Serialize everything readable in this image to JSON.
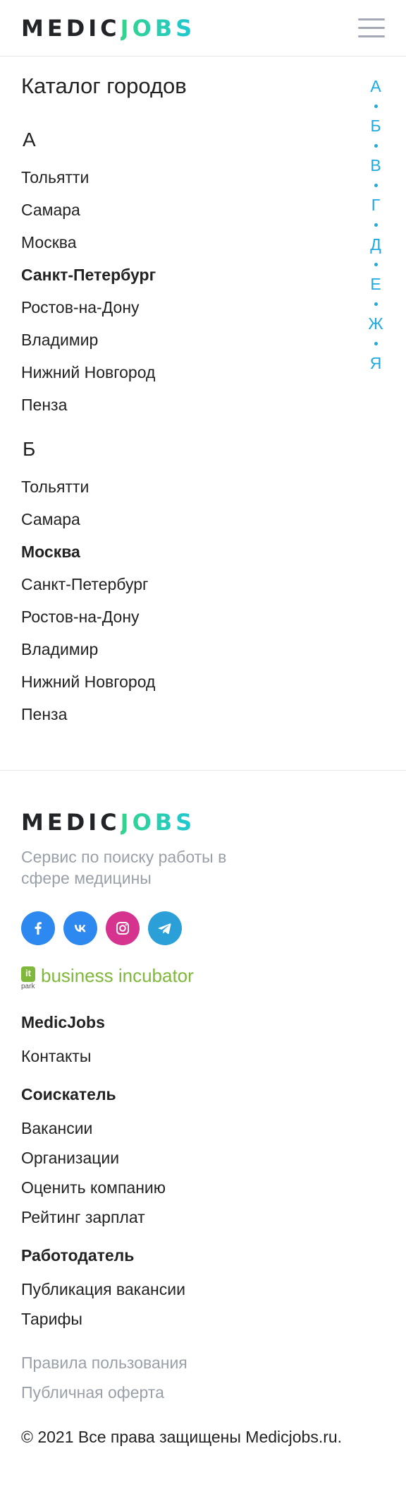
{
  "header": {
    "logo_left": "MEDIC",
    "logo_right": "JOBS",
    "menu_icon": "hamburger-menu-icon"
  },
  "catalog": {
    "title": "Каталог городов",
    "alphabet": [
      "А",
      "Б",
      "В",
      "Г",
      "Д",
      "Е",
      "Ж",
      "Я"
    ],
    "sections": [
      {
        "letter": "А",
        "cities": [
          "Тольятти",
          "Самара",
          "Москва",
          "Санкт-Петербург",
          "Ростов-на-Дону",
          "Владимир",
          "Нижний Новгород",
          "Пенза"
        ],
        "active_city": "Санкт-Петербург"
      },
      {
        "letter": "Б",
        "cities": [
          "Тольятти",
          "Самара",
          "Москва",
          "Санкт-Петербург",
          "Ростов-на-Дону",
          "Владимир",
          "Нижний Новгород",
          "Пенза"
        ],
        "active_city": "Москва"
      }
    ]
  },
  "footer": {
    "logo_left": "MEDIC",
    "logo_right": "JOBS",
    "tagline": "Сервис по поиску работы в сфере медицины",
    "social": [
      {
        "icon": "facebook-icon",
        "color": "#2d88f0"
      },
      {
        "icon": "vk-icon",
        "color": "#2d88f0"
      },
      {
        "icon": "instagram-icon",
        "color": "#d6338f"
      },
      {
        "icon": "telegram-icon",
        "color": "#2a9fd8"
      }
    ],
    "incubator": {
      "badge": "it",
      "badge_sub": "park",
      "text": "business incubator",
      "color": "#7fb83a"
    },
    "medicjobs": {
      "heading": "MedicJobs",
      "links": [
        "Контакты"
      ]
    },
    "seeker": {
      "heading": "Соискатель",
      "links": [
        "Вакансии",
        "Организации",
        "Оценить компанию",
        "Рейтинг зарплат"
      ]
    },
    "employer": {
      "heading": "Работодатель",
      "links": [
        "Публикация вакансии",
        "Тарифы"
      ]
    },
    "legal": [
      "Правила пользования",
      "Публичная оферта"
    ],
    "copyright": "© 2021 Все права защищены Medicjobs.ru."
  },
  "colors": {
    "accent_blue": "#1fa9e1",
    "logo_green": "#34d58c",
    "logo_cyan": "#1fc6d4",
    "muted_text": "#9aa0a8"
  }
}
